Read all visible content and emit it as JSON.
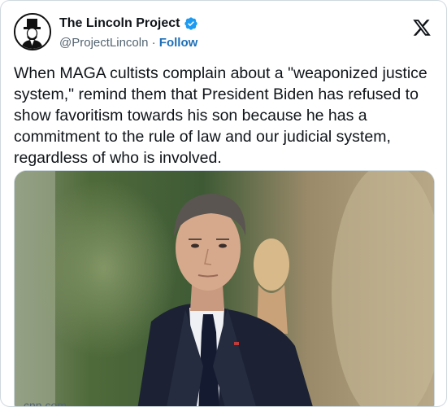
{
  "account": {
    "display_name": "The Lincoln Project",
    "handle": "@ProjectLincoln",
    "separator": "·",
    "follow_label": "Follow",
    "verified": true
  },
  "tweet": {
    "text": "When MAGA cultists complain about a \"weaponized justice system,\" remind them that President Biden has refused to show favoritism towards his son because he has a commitment to the rule of law and our judicial system, regardless of who is involved."
  },
  "link_card": {
    "domain": "cnn.com"
  },
  "colors": {
    "text": "#0f1419",
    "muted": "#536471",
    "follow": "#1d6fb8",
    "verified": "#1d9bf0",
    "border": "#cfd9de"
  },
  "icons": [
    "avatar-lincoln-icon",
    "verified-badge-icon",
    "x-logo-icon"
  ]
}
